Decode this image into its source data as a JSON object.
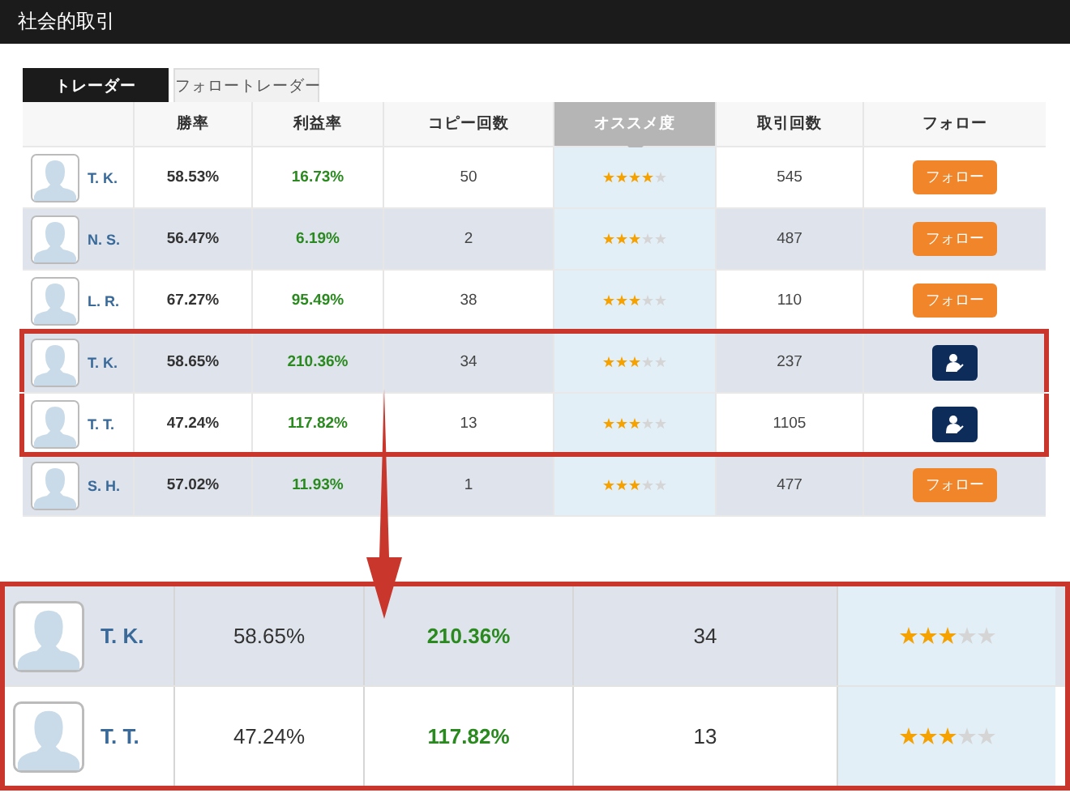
{
  "window": {
    "title": "社会的取引"
  },
  "tabs": [
    {
      "label": "トレーダー",
      "selected": true
    },
    {
      "label": "フォロートレーダー",
      "selected": false
    }
  ],
  "columns": [
    {
      "label": "勝率",
      "selected": false
    },
    {
      "label": "利益率",
      "selected": false
    },
    {
      "label": "コピー回数",
      "selected": false
    },
    {
      "label": "オススメ度",
      "selected": true
    },
    {
      "label": "取引回数",
      "selected": false
    },
    {
      "label": "フォロー",
      "selected": false
    }
  ],
  "rows": [
    {
      "name": "T. K.",
      "win_rate": "58.53%",
      "profit_rate": "16.73%",
      "copies": "50",
      "stars": 4,
      "trades": "545",
      "following": false,
      "follow_label": "フォロー",
      "highlighted": false
    },
    {
      "name": "N. S.",
      "win_rate": "56.47%",
      "profit_rate": "6.19%",
      "copies": "2",
      "stars": 3,
      "trades": "487",
      "following": false,
      "follow_label": "フォロー",
      "highlighted": false
    },
    {
      "name": "L. R.",
      "win_rate": "67.27%",
      "profit_rate": "95.49%",
      "copies": "38",
      "stars": 3,
      "trades": "110",
      "following": false,
      "follow_label": "フォロー",
      "highlighted": false
    },
    {
      "name": "T. K.",
      "win_rate": "58.65%",
      "profit_rate": "210.36%",
      "copies": "34",
      "stars": 3,
      "trades": "237",
      "following": true,
      "highlighted": true
    },
    {
      "name": "T. T.",
      "win_rate": "47.24%",
      "profit_rate": "117.82%",
      "copies": "13",
      "stars": 3,
      "trades": "1105",
      "following": true,
      "highlighted": true
    },
    {
      "name": "S. H.",
      "win_rate": "57.02%",
      "profit_rate": "11.93%",
      "copies": "1",
      "stars": 3,
      "trades": "477",
      "following": false,
      "follow_label": "フォロー",
      "highlighted": false
    }
  ],
  "zoom": {
    "rows": [
      {
        "name": "T. K.",
        "win_rate": "58.65%",
        "profit_rate": "210.36%",
        "copies": "34",
        "stars": 3
      },
      {
        "name": "T. T.",
        "win_rate": "47.24%",
        "profit_rate": "117.82%",
        "copies": "13",
        "stars": 3
      }
    ]
  }
}
